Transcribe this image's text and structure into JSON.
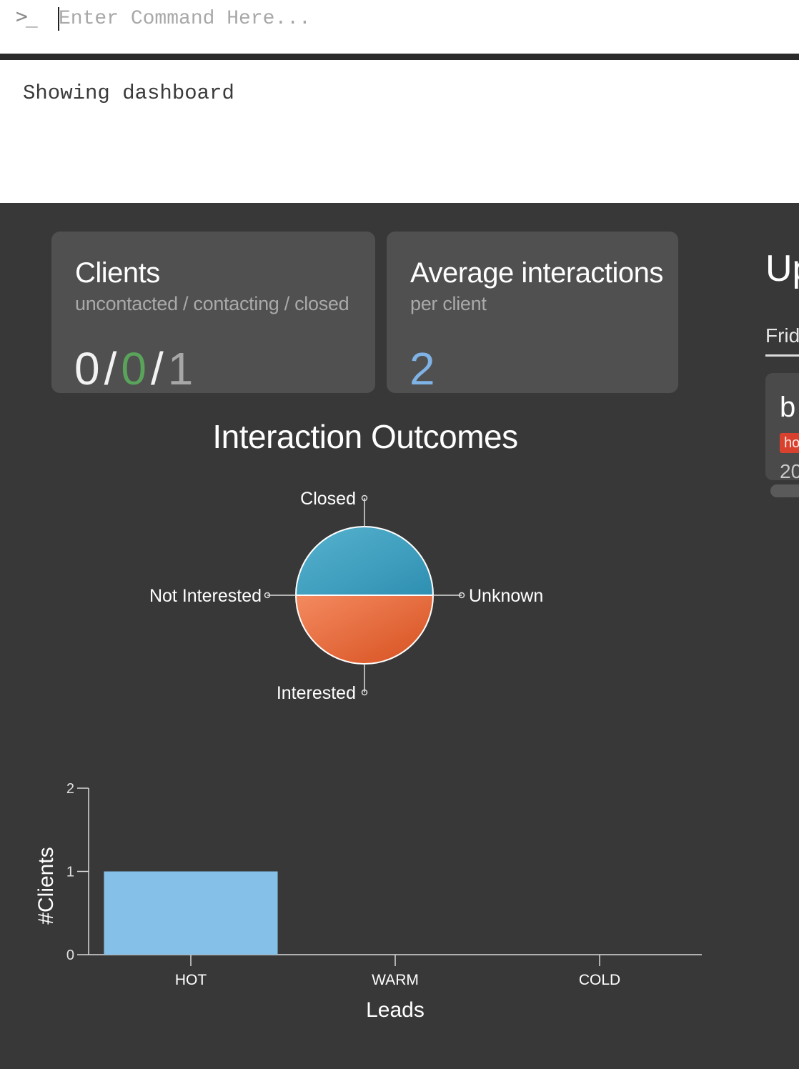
{
  "command_box": {
    "placeholder": "Enter Command Here...",
    "prompt_icon": "terminal-prompt-icon"
  },
  "result_display": {
    "text": "Showing dashboard"
  },
  "dashboard": {
    "clients_card": {
      "title": "Clients",
      "subtitle": "uncontacted / contacting / closed",
      "uncontacted": "0",
      "contacting": "0",
      "closed": "1",
      "separator": "/"
    },
    "average_card": {
      "title": "Average interactions",
      "subtitle": "per client",
      "value": "2"
    },
    "upcoming": {
      "title_partial": "Up",
      "day_partial": "Frid",
      "card": {
        "name_partial": "b",
        "tag_partial": "ho",
        "date_partial": "20"
      }
    }
  },
  "colors": {
    "background": "#383838",
    "card": "#505050",
    "green": "#5aa35a",
    "blue": "#7fb2e5",
    "pie_closed": "#3e9dbd",
    "pie_interested": "#e8683a",
    "bar": "#85c0e8",
    "tag": "#d9412f"
  },
  "chart_data": [
    {
      "type": "pie",
      "title": "Interaction Outcomes",
      "categories": [
        "Closed",
        "Interested",
        "Not Interested",
        "Unknown"
      ],
      "values": [
        1,
        1,
        0,
        0
      ]
    },
    {
      "type": "bar",
      "categories": [
        "HOT",
        "WARM",
        "COLD"
      ],
      "values": [
        1,
        0,
        0
      ],
      "xlabel": "Leads",
      "ylabel": "#Clients",
      "ylim": [
        0,
        2
      ],
      "yticks": [
        "0",
        "1",
        "2"
      ]
    }
  ]
}
